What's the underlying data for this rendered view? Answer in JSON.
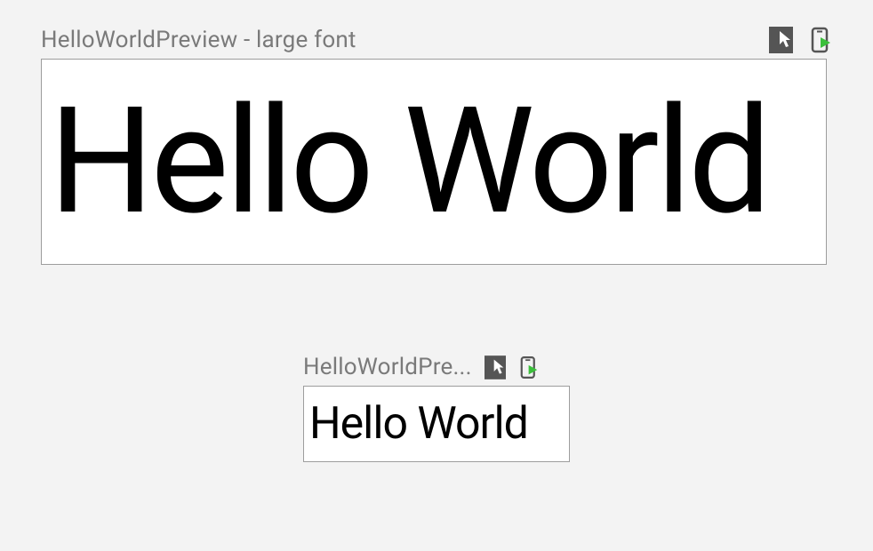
{
  "previews": [
    {
      "title": "HelloWorldPreview - large font",
      "text": "Hello World"
    },
    {
      "title": "HelloWorldPre...",
      "text": "Hello World"
    }
  ]
}
